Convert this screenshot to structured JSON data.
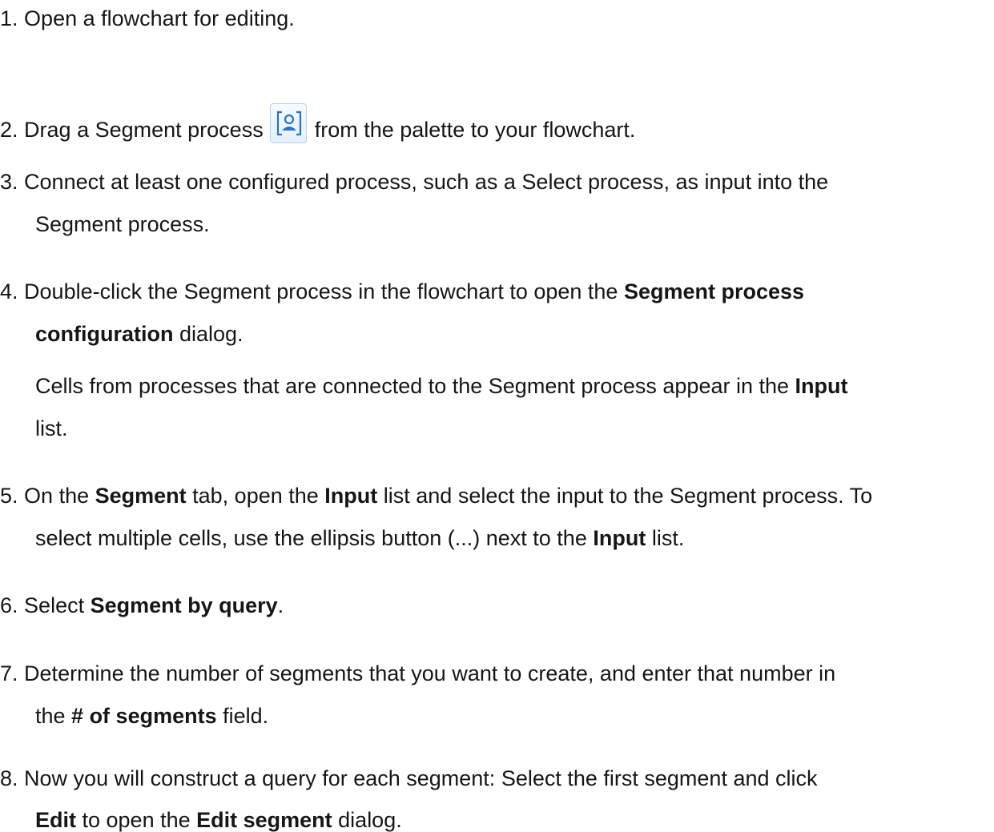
{
  "steps": [
    {
      "number": "1.",
      "text": "Open a flowchart for editing."
    },
    {
      "number": "2.",
      "before_icon": "Drag a Segment process",
      "icon": "segment-process-icon",
      "after_icon": "from the palette to your flowchart."
    },
    {
      "number": "3.",
      "line1": "Connect at least one configured process, such as a Select process, as input into the",
      "line2": "Segment process."
    },
    {
      "number": "4.",
      "line1_pre": "Double-click the Segment process in the flowchart to open the ",
      "line1_bold": "Segment process",
      "line2_bold": "configuration",
      "line2_post": " dialog.",
      "note_line1_pre": "Cells from processes that are connected to the Segment process appear in the ",
      "note_line1_bold": "Input",
      "note_line2": "list."
    },
    {
      "number": "5.",
      "a": "On the ",
      "b": "Segment",
      "c": " tab, open the ",
      "d": "Input",
      "e": " list and select the input to the Segment process. To",
      "f": "select multiple cells, use the ellipsis button (...) next to the ",
      "g": "Input",
      "h": " list."
    },
    {
      "number": "6.",
      "pre": "Select ",
      "bold": "Segment by query",
      "post": "."
    },
    {
      "number": "7.",
      "line1": "Determine the number of segments that you want to create, and enter that number in",
      "line2_pre": "the ",
      "line2_bold": "# of segments",
      "line2_post": " field."
    },
    {
      "number": "8.",
      "line1": "Now you will construct a query for each segment: Select the first segment and click",
      "line2_bold1": "Edit",
      "line2_mid": " to open the ",
      "line2_bold2": "Edit segment",
      "line2_post": " dialog."
    }
  ]
}
